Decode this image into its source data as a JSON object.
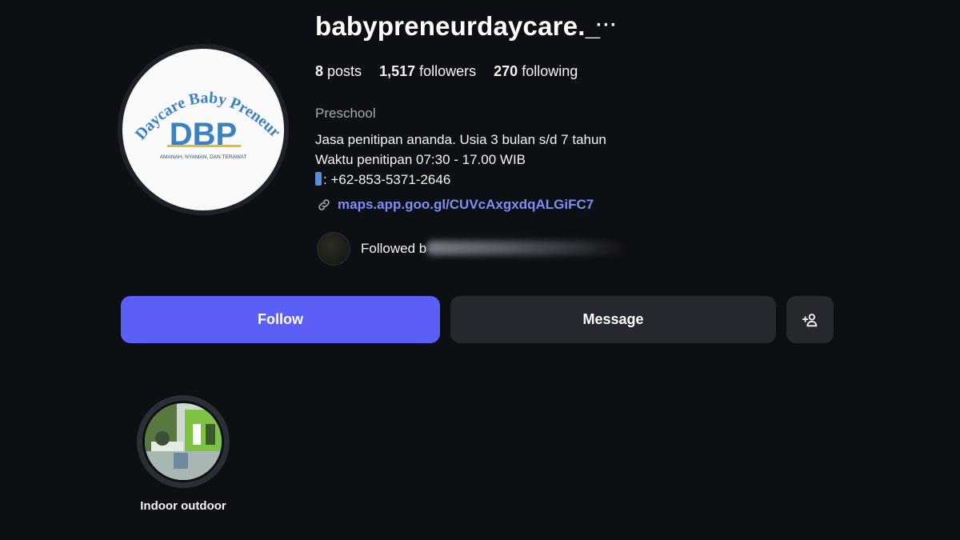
{
  "profile": {
    "username": "babypreneurdaycare._",
    "more_label": "···",
    "avatar_logo": {
      "arc_text": "Daycare Baby Preneur",
      "monogram": "DBP",
      "tagline": "AMANAH, NYAMAN, DAN TERAWAT"
    },
    "stats": {
      "posts_count": "8",
      "posts_label": "posts",
      "followers_count": "1,517",
      "followers_label": "followers",
      "following_count": "270",
      "following_label": "following"
    },
    "category": "Preschool",
    "bio": {
      "line1": "Jasa penitipan ananda. Usia 3 bulan s/d 7 tahun",
      "line2": "Waktu penitipan 07:30 - 17.00 WIB",
      "line3": ": +62-853-5371-2646"
    },
    "link": "maps.app.goo.gl/CUVcAxgxdqALGiFC7",
    "followed_by_prefix": "Followed b"
  },
  "actions": {
    "follow_label": "Follow",
    "message_label": "Message",
    "add_user_icon": "add-user-icon"
  },
  "highlights": [
    {
      "label": "Indoor outdoor"
    }
  ],
  "colors": {
    "background": "#0c0f14",
    "follow_button": "#5b5ff7",
    "secondary_button": "#25282f",
    "link": "#7b8ff5",
    "logo_blue": "#3b82c4",
    "logo_yellow": "#e8b92a"
  }
}
